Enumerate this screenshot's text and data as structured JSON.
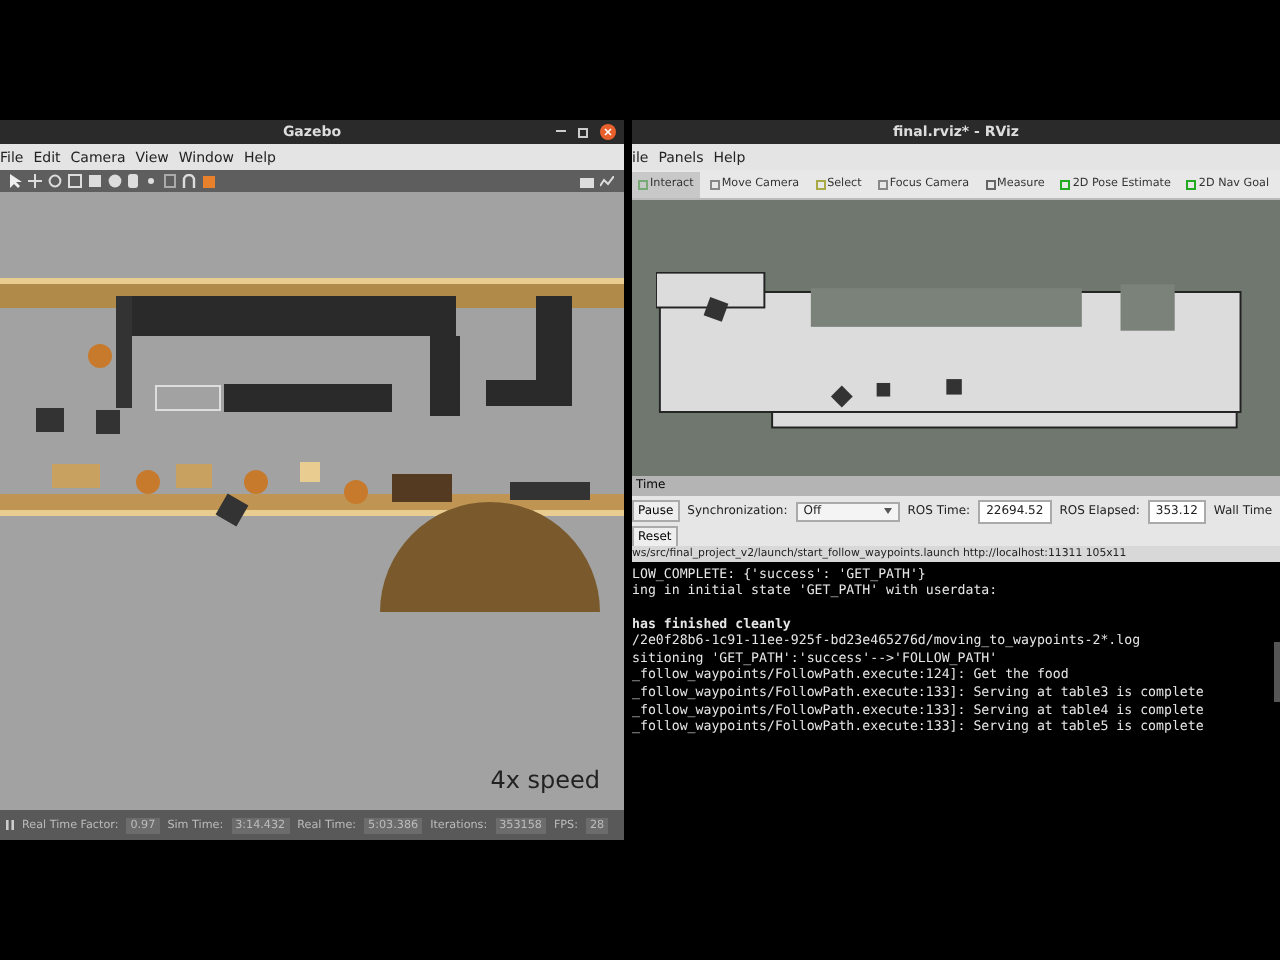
{
  "gazebo": {
    "title": "Gazebo",
    "menu": [
      "File",
      "Edit",
      "Camera",
      "View",
      "Window",
      "Help"
    ],
    "overlay_caption": "4x speed",
    "status": [
      {
        "label": "Real Time Factor:",
        "value": "0.97"
      },
      {
        "label": "Sim Time:",
        "value": "3:14.432"
      },
      {
        "label": "Real Time:",
        "value": "5:03.386"
      },
      {
        "label": "Iterations:",
        "value": "353158"
      },
      {
        "label": "FPS:",
        "value": "28"
      }
    ]
  },
  "rviz": {
    "title": "final.rviz* - RViz",
    "menu": [
      "ile",
      "Panels",
      "Help"
    ],
    "tools": [
      {
        "label": "Interact",
        "selected": true
      },
      {
        "label": "Move Camera",
        "selected": false
      },
      {
        "label": "Select",
        "selected": false
      },
      {
        "label": "Focus Camera",
        "selected": false
      },
      {
        "label": "Measure",
        "selected": false
      },
      {
        "label": "2D Pose Estimate",
        "selected": false
      },
      {
        "label": "2D Nav Goal",
        "selected": false
      }
    ],
    "time_panel": {
      "title": "Time",
      "pause_button": "Pause",
      "sync_label": "Synchronization:",
      "sync_value": "Off",
      "ros_time_label": "ROS Time:",
      "ros_time": "22694.52",
      "ros_elapsed_label": "ROS Elapsed:",
      "ros_elapsed": "353.12",
      "wall_time_label": "Wall Time",
      "reset_button": "Reset"
    }
  },
  "terminal": {
    "title": "ws/src/final_project_v2/launch/start_follow_waypoints.launch http://localhost:11311 105x11",
    "lines": [
      {
        "text": "LOW_COMPLETE: {'success': 'GET_PATH'}",
        "kind": "plain"
      },
      {
        "text": "ing in initial state 'GET_PATH' with userdata:",
        "kind": "plain"
      },
      {
        "text": "has finished cleanly",
        "kind": "bold"
      },
      {
        "text": "/2e0f28b6-1c91-11ee-925f-bd23e465276d/moving_to_waypoints-2*.log",
        "kind": "plain"
      },
      {
        "text": "sitioning 'GET_PATH':'success'-->'FOLLOW_PATH'",
        "kind": "plain"
      },
      {
        "text": "_follow_waypoints/FollowPath.execute:124]: Get the food",
        "kind": "plain"
      },
      {
        "text": "_follow_waypoints/FollowPath.execute:133]: Serving at table3 is complete",
        "kind": "plain"
      },
      {
        "text": "_follow_waypoints/FollowPath.execute:133]: Serving at table4 is complete",
        "kind": "plain"
      },
      {
        "text": "_follow_waypoints/FollowPath.execute:133]: Serving at table5 is complete",
        "kind": "plain"
      }
    ]
  }
}
